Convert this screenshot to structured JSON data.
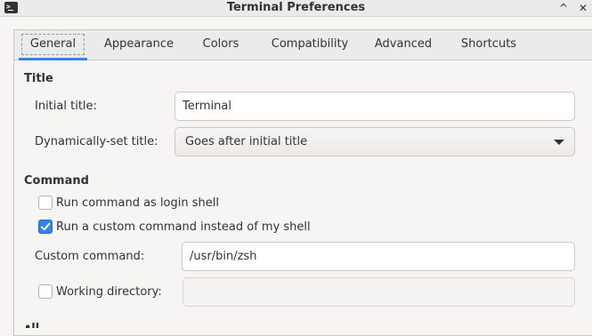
{
  "window": {
    "title": "Terminal Preferences",
    "icon": "terminal-app-icon",
    "buttons": {
      "maximize": "^",
      "close": "✕"
    }
  },
  "tabs": [
    {
      "label": "General",
      "active": true
    },
    {
      "label": "Appearance",
      "active": false
    },
    {
      "label": "Colors",
      "active": false
    },
    {
      "label": "Compatibility",
      "active": false
    },
    {
      "label": "Advanced",
      "active": false
    },
    {
      "label": "Shortcuts",
      "active": false
    }
  ],
  "title_section": {
    "heading": "Title",
    "initial_title_label": "Initial title:",
    "initial_title_value": "Terminal",
    "dynamic_title_label": "Dynamically-set title:",
    "dynamic_title_value": "Goes after initial title"
  },
  "command_section": {
    "heading": "Command",
    "login_shell_label": "Run command as login shell",
    "login_shell_checked": false,
    "custom_command_toggle_label": "Run a custom command instead of my shell",
    "custom_command_toggle_checked": true,
    "custom_command_label": "Custom command:",
    "custom_command_value": "/usr/bin/zsh",
    "working_dir_label": "Working directory:",
    "working_dir_checked": false,
    "working_dir_value": ""
  },
  "colors": {
    "accent": "#3584e4",
    "text": "#2e3436",
    "window_bg": "#f6f5f4"
  }
}
